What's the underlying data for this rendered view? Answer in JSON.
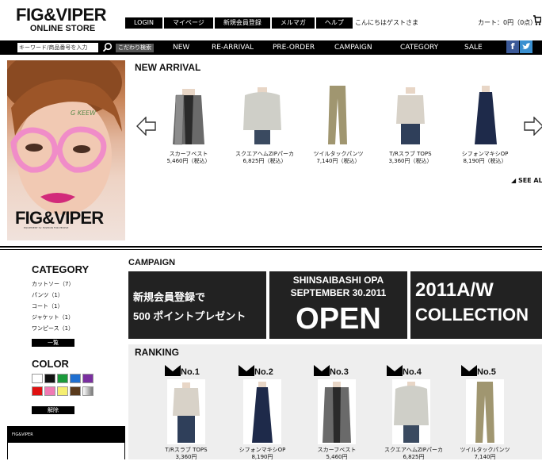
{
  "header": {
    "logo_main": "FIG&VIPER",
    "logo_sub": "ONLINE STORE",
    "top_nav": [
      "LOGIN",
      "マイページ",
      "新規会員登録",
      "メルマガ",
      "ヘルプ"
    ],
    "greeting": "こんにちはゲストさま",
    "cart": "カート：0円（0点）"
  },
  "navbar": {
    "search_placeholder": "キーワード/商品番号を入力",
    "advanced_search": "こだわり検索",
    "items": [
      "NEW",
      "RE-ARRIVAL",
      "PRE-ORDER",
      "CAMPAIGN",
      "CATEGORY",
      "SALE"
    ],
    "social": [
      "facebook-icon",
      "twitter-icon"
    ]
  },
  "hero": {
    "logo": "FIG&VIPER",
    "tagline": "EQUIPMENT for FASHION FOR PEOPLE",
    "scribble": "G KEEW"
  },
  "new_arrival": {
    "title": "NEW ARRIVAL",
    "products": [
      {
        "name": "スカーフベスト",
        "price": "5,460円（税込）"
      },
      {
        "name": "スクエアヘムZIPパーカ",
        "price": "6,825円（税込）"
      },
      {
        "name": "ツイルタックパンツ",
        "price": "7,140円（税込）"
      },
      {
        "name": "T/Rスラブ TOPS",
        "price": "3,360円（税込）"
      },
      {
        "name": "シフォンマキシOP",
        "price": "8,190円（税込）"
      }
    ],
    "see_all": "◢ SEE AL"
  },
  "sidebar": {
    "category_title": "CATEGORY",
    "categories": [
      "カットソー（7）",
      "パンツ（1）",
      "コート（1）",
      "ジャケット（1）",
      "ワンピース（1）"
    ],
    "list_button": "一覧",
    "color_title": "COLOR",
    "colors": [
      "#ffffff",
      "#111111",
      "#1a9a3a",
      "#1f6fd0",
      "#7a2fa0",
      "#e01010",
      "#f07ab4",
      "#f5ee70",
      "#5a3a1c",
      "#b0b0b0"
    ],
    "clear_button": "解除",
    "brand_box": "FIG&VIPER"
  },
  "campaign": {
    "title": "CAMPAIGN",
    "banner1_line1": "新規会員登録で",
    "banner1_line2": "500 ポイントプレゼント",
    "banner2_line1": "SHINSAIBASHI OPA",
    "banner2_line2": "SEPTEMBER 30.2011",
    "banner2_line3": "OPEN",
    "banner3_line1": "2011A/W",
    "banner3_line2": "COLLECTION"
  },
  "ranking": {
    "title": "RANKING",
    "items": [
      {
        "rank": "No.1",
        "name": "T/Rスラブ TOPS",
        "price": "3,360円"
      },
      {
        "rank": "No.2",
        "name": "シフォンマキシOP",
        "price": "8,190円"
      },
      {
        "rank": "No.3",
        "name": "スカーフベスト",
        "price": "5,460円"
      },
      {
        "rank": "No.4",
        "name": "スクエアヘムZIPパーカ",
        "price": "6,825円"
      },
      {
        "rank": "No.5",
        "name": "ツイルタックパンツ",
        "price": "7,140円"
      }
    ]
  }
}
